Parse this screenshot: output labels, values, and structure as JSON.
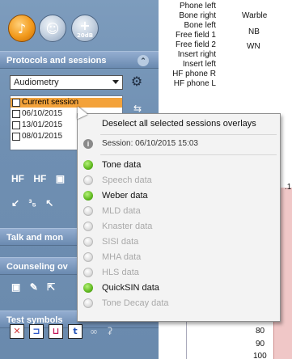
{
  "sidebar": {
    "sections": {
      "protocols": "Protocols and sessions",
      "talk": "Talk and mon",
      "counseling": "Counseling ov",
      "symbols": "Test symbols"
    },
    "protocol_select": "Audiometry",
    "sessions": [
      {
        "label": "Current session",
        "current": true
      },
      {
        "label": "06/10/2015",
        "current": false
      },
      {
        "label": "13/01/2015",
        "current": false
      },
      {
        "label": "08/01/2015",
        "current": false
      }
    ],
    "top_buttons": [
      {
        "icon": "music-note-icon",
        "glyph": "♪"
      },
      {
        "icon": "speech-head-icon",
        "glyph": "☺"
      },
      {
        "icon": "plus-20db-icon",
        "glyph": "+",
        "sub": "20dB"
      }
    ],
    "tools1": [
      "HF",
      "HF",
      "▣"
    ],
    "tools2": [
      "↙",
      "³₅",
      "↖"
    ],
    "symbol_colors": [
      "#d23b3b",
      "#2b56c9",
      "#c2185b",
      "#1f4fb5"
    ]
  },
  "right_panel": {
    "outputs": [
      "Phone left",
      "Bone right",
      "Bone left",
      "Free field 1",
      "Free field 2",
      "Insert right",
      "Insert left",
      "HF phone R",
      "HF phone L"
    ],
    "stimulus": [
      "Warble",
      "NB",
      "WN"
    ],
    "axis_numbers": [
      "80",
      "90",
      "100"
    ],
    "partial_label": ".1"
  },
  "context_menu": {
    "deselect": "Deselect all selected sessions overlays",
    "session": "Session: 06/10/2015  15:03",
    "items": [
      {
        "label": "Tone data",
        "enabled": true,
        "checked": true
      },
      {
        "label": "Speech data",
        "enabled": false,
        "checked": false
      },
      {
        "label": "Weber data",
        "enabled": true,
        "checked": true
      },
      {
        "label": "MLD data",
        "enabled": false,
        "checked": false
      },
      {
        "label": "Knaster data",
        "enabled": false,
        "checked": false
      },
      {
        "label": "SISI data",
        "enabled": false,
        "checked": false
      },
      {
        "label": "MHA data",
        "enabled": false,
        "checked": false
      },
      {
        "label": "HLS data",
        "enabled": false,
        "checked": false
      },
      {
        "label": "QuickSIN data",
        "enabled": true,
        "checked": true
      },
      {
        "label": "Tone Decay data",
        "enabled": false,
        "checked": false
      }
    ]
  },
  "colors": {
    "accent": "#f3a23a",
    "sidebar": "#6f8fb2",
    "menu_bg": "#f3f3f3"
  }
}
